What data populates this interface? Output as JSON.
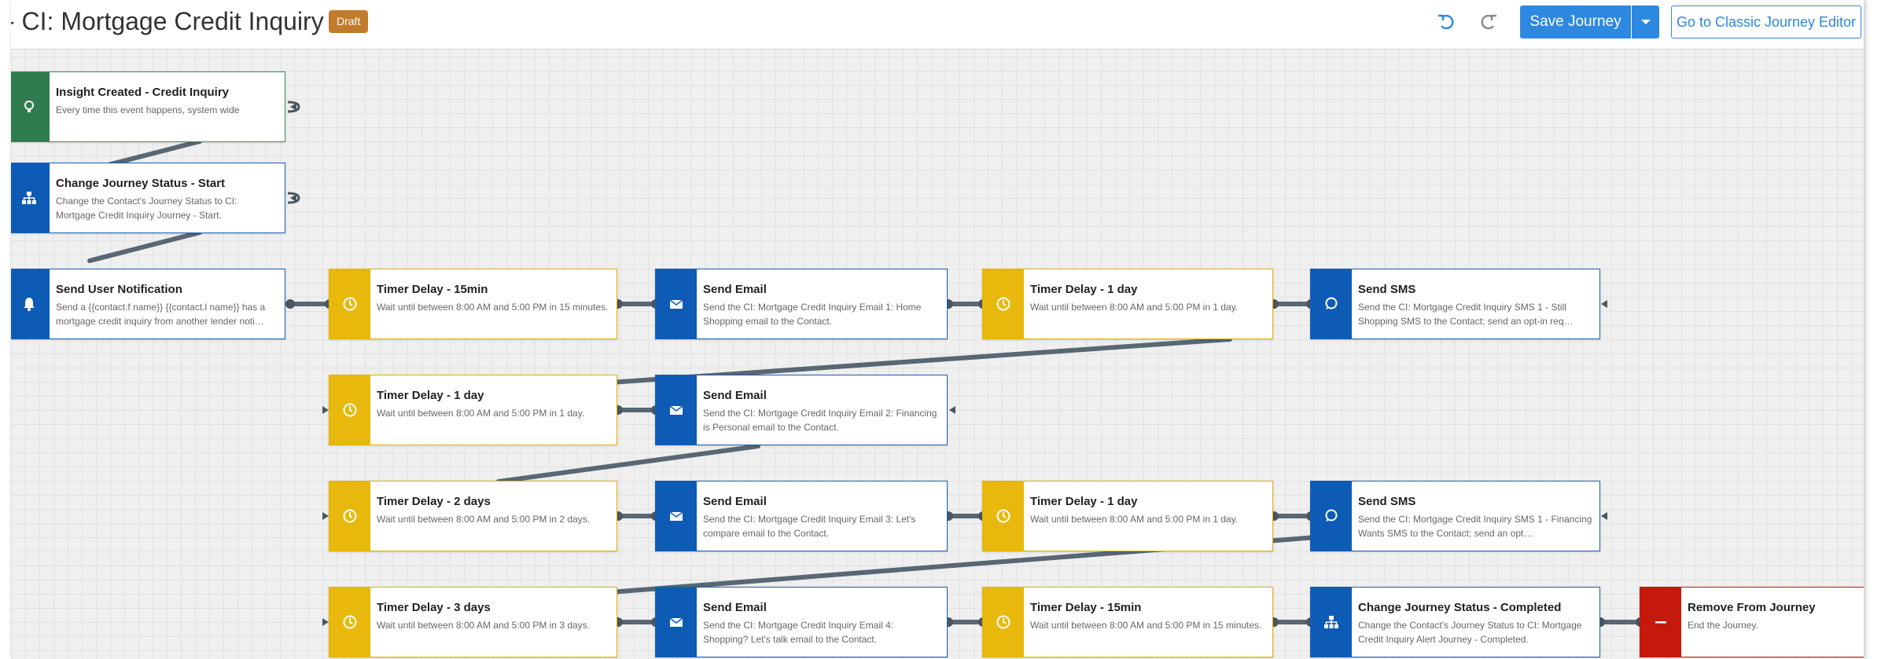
{
  "header": {
    "title": "- CI: Mortgage Credit Inquiry",
    "badge": "Draft",
    "save_label": "Save Journey",
    "classic_label": "Go to Classic Journey Editor"
  },
  "colors": {
    "trigger": "#2f7d4f",
    "action": "#0d5bb5",
    "timer": "#e8b90c",
    "exit": "#c4190c",
    "accent": "#2d88e0",
    "badge": "#c17b2a"
  },
  "nodes": {
    "n1": {
      "title": "Insight Created - Credit Inquiry",
      "desc": "Every time this event happens, system wide",
      "icon": "lightbulb-icon"
    },
    "n2": {
      "title": "Change Journey Status - Start",
      "desc": "Change the Contact's Journey Status to CI: Mortgage Credit Inquiry Journey - Start.",
      "icon": "hierarchy-icon"
    },
    "n3": {
      "title": "Send User Notification",
      "desc": "Send a {{contact.f  name}} {{contact.l  name}} has a mortgage credit inquiry from another lender noti…",
      "icon": "bell-icon"
    },
    "n4": {
      "title": "Timer Delay - 15min",
      "desc": "Wait until between 8:00 AM and 5:00 PM in 15 minutes.",
      "icon": "clock-icon"
    },
    "n5": {
      "title": "Send Email",
      "desc": "Send the CI: Mortgage Credit Inquiry Email 1: Home Shopping email to the Contact.",
      "icon": "envelope-icon"
    },
    "n6": {
      "title": "Timer Delay - 1 day",
      "desc": "Wait until between 8:00 AM and 5:00 PM in 1 day.",
      "icon": "clock-icon"
    },
    "n7": {
      "title": "Send SMS",
      "desc": "Send the CI: Mortgage Credit Inquiry SMS 1 - Still Shopping SMS to the Contact; send an opt-in req…",
      "icon": "chat-icon"
    },
    "n8": {
      "title": "Timer Delay - 1 day",
      "desc": "Wait until between 8:00 AM and 5:00 PM in 1 day.",
      "icon": "clock-icon"
    },
    "n9": {
      "title": "Send Email",
      "desc": "Send the CI: Mortgage Credit Inquiry Email 2: Financing is Personal email to the Contact.",
      "icon": "envelope-icon"
    },
    "n10": {
      "title": "Timer Delay - 2 days",
      "desc": "Wait until between 8:00 AM and 5:00 PM in 2 days.",
      "icon": "clock-icon"
    },
    "n11": {
      "title": "Send Email",
      "desc": "Send the CI: Mortgage Credit Inquiry Email 3: Let's compare email to the Contact.",
      "icon": "envelope-icon"
    },
    "n12": {
      "title": "Timer Delay - 1 day",
      "desc": "Wait until between 8:00 AM and 5:00 PM in 1 day.",
      "icon": "clock-icon"
    },
    "n13": {
      "title": "Send SMS",
      "desc": "Send the CI: Mortgage Credit Inquiry SMS 1 - Financing Wants SMS to the Contact; send an opt…",
      "icon": "chat-icon"
    },
    "n14": {
      "title": "Timer Delay - 3 days",
      "desc": "Wait until between 8:00 AM and 5:00 PM in 3 days.",
      "icon": "clock-icon"
    },
    "n15": {
      "title": "Send Email",
      "desc": "Send the CI: Mortgage Credit Inquiry Email 4: Shopping? Let's talk email to the Contact.",
      "icon": "envelope-icon"
    },
    "n16": {
      "title": "Timer Delay - 15min",
      "desc": "Wait until between 8:00 AM and 5:00 PM in 15 minutes.",
      "icon": "clock-icon"
    },
    "n17": {
      "title": "Change Journey Status - Completed",
      "desc": "Change the Contact's Journey Status to CI: Mortgage Credit Inquiry Alert Journey - Completed.",
      "icon": "hierarchy-icon"
    },
    "n18": {
      "title": "Remove From Journey",
      "desc": "End the Journey.",
      "icon": "minus-icon"
    }
  }
}
